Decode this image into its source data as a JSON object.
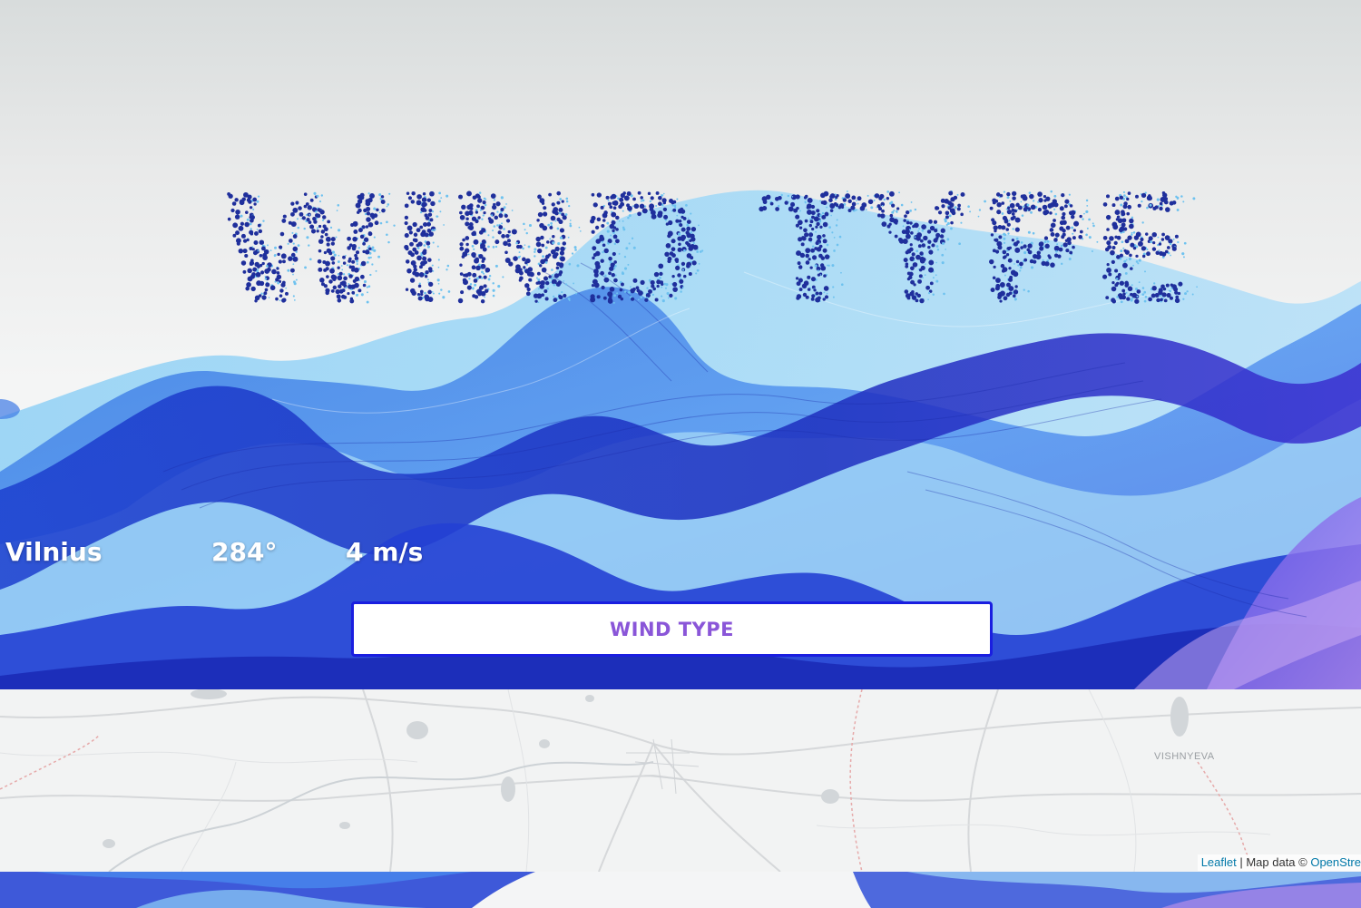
{
  "hero": {
    "title_art": "WIND TYPE"
  },
  "readout": {
    "city": "Vilnius",
    "direction": "284°",
    "speed": "4 m/s"
  },
  "button": {
    "label": "WIND TYPE"
  },
  "map": {
    "place_label": "VISHNYEVA",
    "attribution_link_1": "Leaflet",
    "attribution_separator": " | Map data © ",
    "attribution_link_2": "OpenStre"
  },
  "colors": {
    "accent_button_border": "#1a1ee0",
    "button_text": "#8a56d8",
    "wave_dark": "#1f34c8",
    "wave_mid": "#3f7ae6",
    "wave_light": "#8fd0f5",
    "particle_dark": "#1f2f9c",
    "particle_light": "#6ec2ef"
  }
}
